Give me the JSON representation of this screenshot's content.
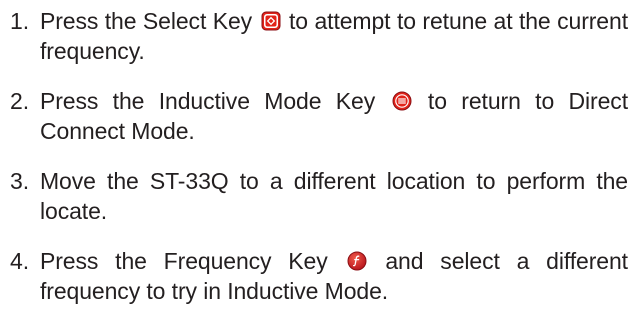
{
  "steps": [
    {
      "number": "1.",
      "before": "Press the Select Key",
      "icon": "select-key-icon",
      "after": "to attempt to retune at the current frequency."
    },
    {
      "number": "2.",
      "before": "Press the Inductive Mode Key",
      "icon": "inductive-mode-key-icon",
      "after": "to return to Direct Connect Mode."
    },
    {
      "number": "3.",
      "text": "Move the ST-33Q to a different location to perform the locate."
    },
    {
      "number": "4.",
      "before": "Press the Frequency Key",
      "icon": "frequency-key-icon",
      "after": "and select a different frequency to try in Inductive Mode."
    }
  ],
  "colors": {
    "key_red": "#e2231a",
    "key_dark_red": "#b5121b",
    "text": "#231f20"
  }
}
